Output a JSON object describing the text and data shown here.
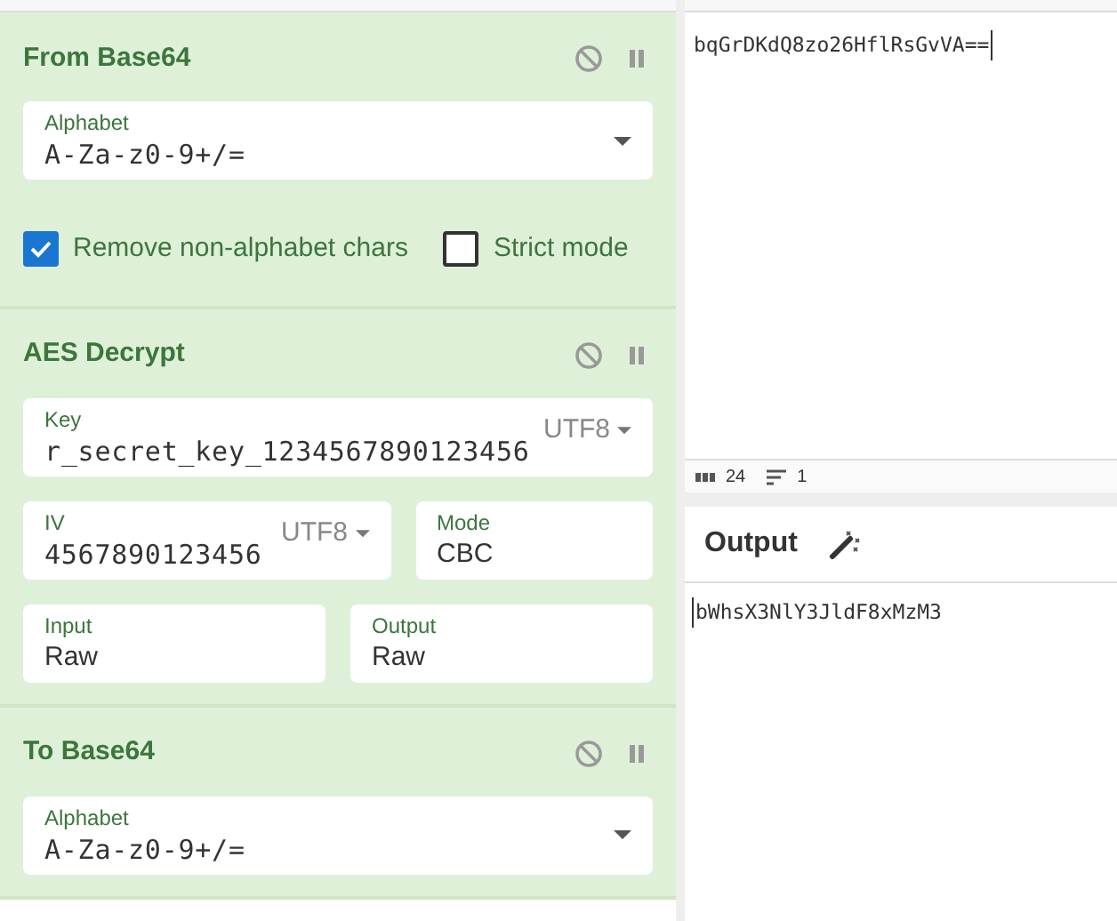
{
  "operations": [
    {
      "title": "From Base64",
      "rows": [
        [
          {
            "kind": "select",
            "label": "Alphabet",
            "value": "A-Za-z0-9+/="
          }
        ]
      ],
      "checkboxes": [
        {
          "label": "Remove non-alphabet chars",
          "checked": true
        },
        {
          "label": "Strict mode",
          "checked": false
        }
      ]
    },
    {
      "title": "AES Decrypt",
      "rows": [
        [
          {
            "kind": "keyed",
            "label": "Key",
            "value": "r_secret_key_1234567890123456",
            "encoding": "UTF8"
          }
        ],
        [
          {
            "kind": "keyed",
            "label": "IV",
            "value": "4567890123456",
            "encoding": "UTF8"
          },
          {
            "kind": "plain",
            "label": "Mode",
            "value": "CBC"
          }
        ],
        [
          {
            "kind": "plain",
            "label": "Input",
            "value": "Raw"
          },
          {
            "kind": "plain",
            "label": "Output",
            "value": "Raw"
          }
        ]
      ]
    },
    {
      "title": "To Base64",
      "rows": [
        [
          {
            "kind": "select",
            "label": "Alphabet",
            "value": "A-Za-z0-9+/="
          }
        ]
      ]
    }
  ],
  "input": {
    "text": "bqGrDKdQ8zo26HflRsGvVA==",
    "length": "24",
    "lines": "1"
  },
  "output": {
    "title": "Output",
    "text": "bWhsX3NlY3JldF8xMzM3"
  }
}
